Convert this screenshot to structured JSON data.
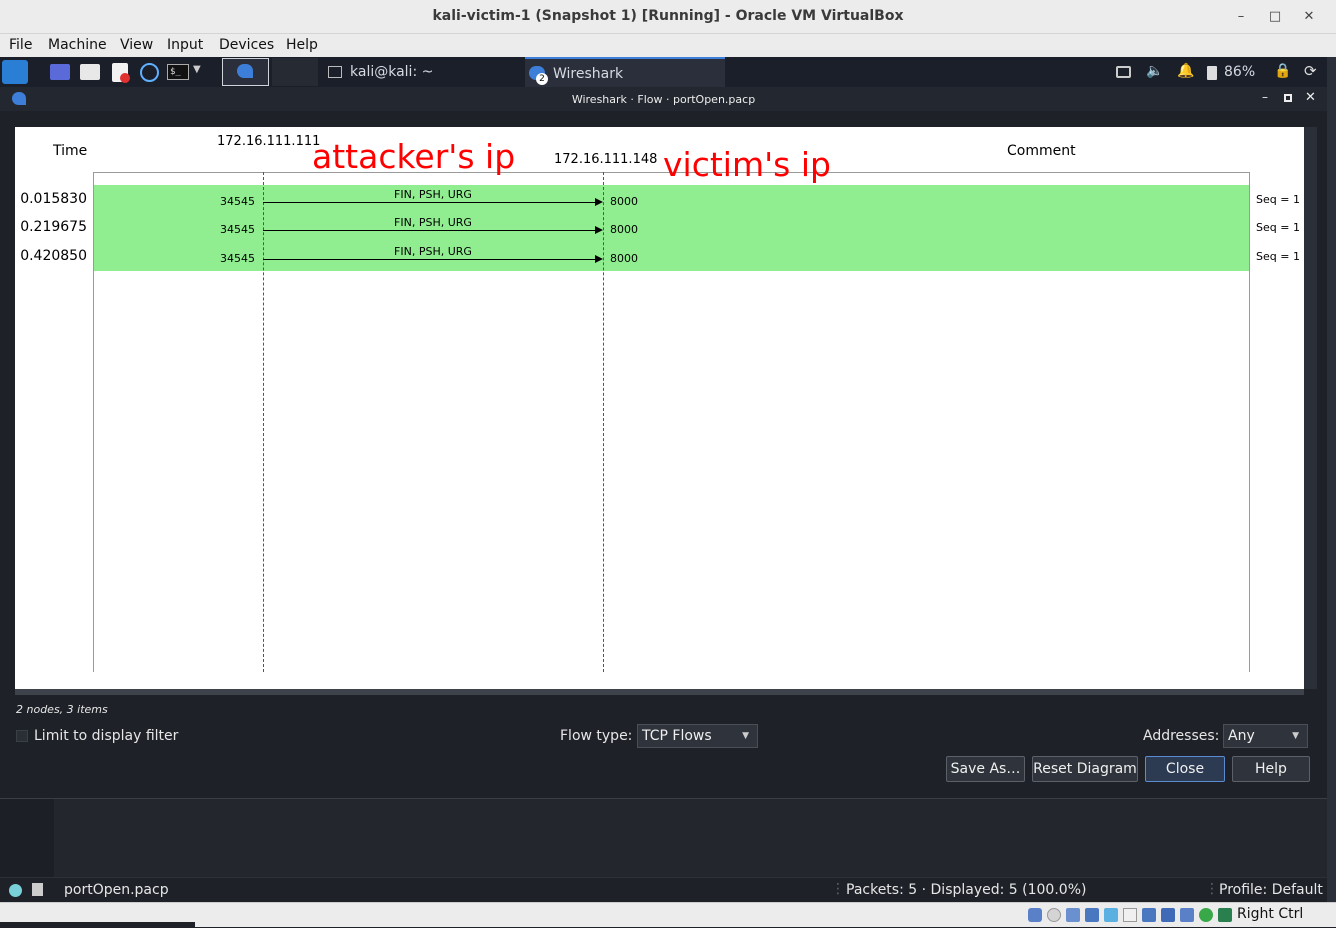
{
  "host_window": {
    "title": "kali-victim-1 (Snapshot 1) [Running] - Oracle VM VirtualBox",
    "menu": [
      "File",
      "Machine",
      "View",
      "Input",
      "Devices",
      "Help"
    ]
  },
  "kali_panel": {
    "terminal_task": "kali@kali: ~",
    "wireshark_task": "Wireshark",
    "wireshark_badge": "2",
    "battery": "86%"
  },
  "dialog": {
    "title": "Wireshark · Flow · portOpen.pacp",
    "headers": {
      "time": "Time",
      "node_a": "172.16.111.111",
      "node_b": "172.16.111.148",
      "comment": "Comment"
    },
    "annotations": {
      "attacker": "attacker's ip",
      "victim": "victim's ip"
    },
    "flows": [
      {
        "time": "0.015830",
        "src_port": "34545",
        "label": "FIN, PSH, URG",
        "dst_port": "8000",
        "comment": "Seq = 1"
      },
      {
        "time": "0.219675",
        "src_port": "34545",
        "label": "FIN, PSH, URG",
        "dst_port": "8000",
        "comment": "Seq = 1"
      },
      {
        "time": "0.420850",
        "src_port": "34545",
        "label": "FIN, PSH, URG",
        "dst_port": "8000",
        "comment": "Seq = 1"
      }
    ],
    "summary": "2 nodes, 3 items",
    "limit_filter_label": "Limit to display filter",
    "flow_type_label": "Flow type:",
    "flow_type_value": "TCP Flows",
    "addresses_label": "Addresses:",
    "addresses_value": "Any",
    "buttons": {
      "save_as": "Save As…",
      "reset": "Reset Diagram",
      "close": "Close",
      "help": "Help"
    }
  },
  "wireshark_status": {
    "file": "portOpen.pacp",
    "packets": "Packets: 5 · Displayed: 5 (100.0%)",
    "profile": "Profile: Default"
  },
  "vbox_status": {
    "host_key": "Right Ctrl"
  },
  "colors": {
    "flow_row": "#90ee90",
    "annotation": "#ff0000",
    "dialog_bg": "#1e2128"
  }
}
